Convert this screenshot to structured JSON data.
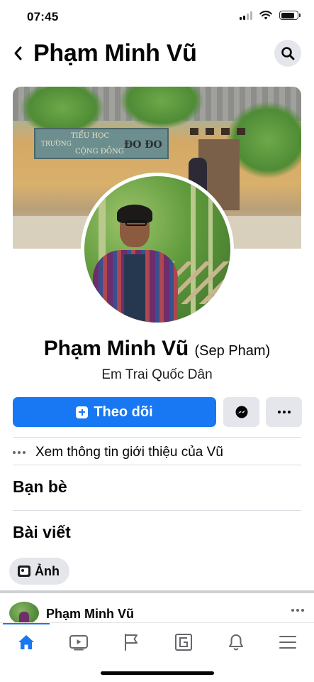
{
  "status_bar": {
    "time": "07:45",
    "icons": [
      "signal-icon",
      "wifi-icon",
      "battery-icon"
    ],
    "battery_level_percent": 85
  },
  "header": {
    "title": "Phạm Minh Vũ",
    "back_icon": "chevron-left-icon",
    "search_icon": "search-icon"
  },
  "cover": {
    "sign_line1": "TIỂU HỌC",
    "sign_line2": "TRƯỜNG",
    "sign_line3": "CỘNG ĐỒNG",
    "sign_line4": "ĐO ĐO"
  },
  "profile": {
    "name": "Phạm Minh Vũ",
    "alternate_name": "(Sep Pham)",
    "bio": "Em Trai Quốc Dân"
  },
  "actions": {
    "follow_label": "Theo dõi",
    "follow_icon": "follow-plus-icon",
    "message_icon": "messenger-icon",
    "more_icon": "more-dots-icon"
  },
  "about": {
    "label": "Xem thông tin giới thiệu của Vũ",
    "icon": "more-dots-icon"
  },
  "sections": {
    "friends": "Bạn bè",
    "posts": "Bài viết",
    "photos_chip": "Ảnh"
  },
  "post": {
    "author": "Phạm Minh Vũ"
  },
  "colors": {
    "accent": "#1877f2",
    "secondary_button": "#e4e6eb",
    "text": "#050505",
    "muted": "#65676b"
  },
  "tab_bar": {
    "tabs": [
      {
        "name": "home",
        "icon": "home-icon",
        "active": true
      },
      {
        "name": "watch",
        "icon": "video-icon",
        "active": false
      },
      {
        "name": "pages",
        "icon": "flag-icon",
        "active": false
      },
      {
        "name": "gaming",
        "icon": "gaming-icon",
        "active": false
      },
      {
        "name": "notifications",
        "icon": "bell-icon",
        "active": false
      },
      {
        "name": "menu",
        "icon": "menu-icon",
        "active": false
      }
    ]
  }
}
